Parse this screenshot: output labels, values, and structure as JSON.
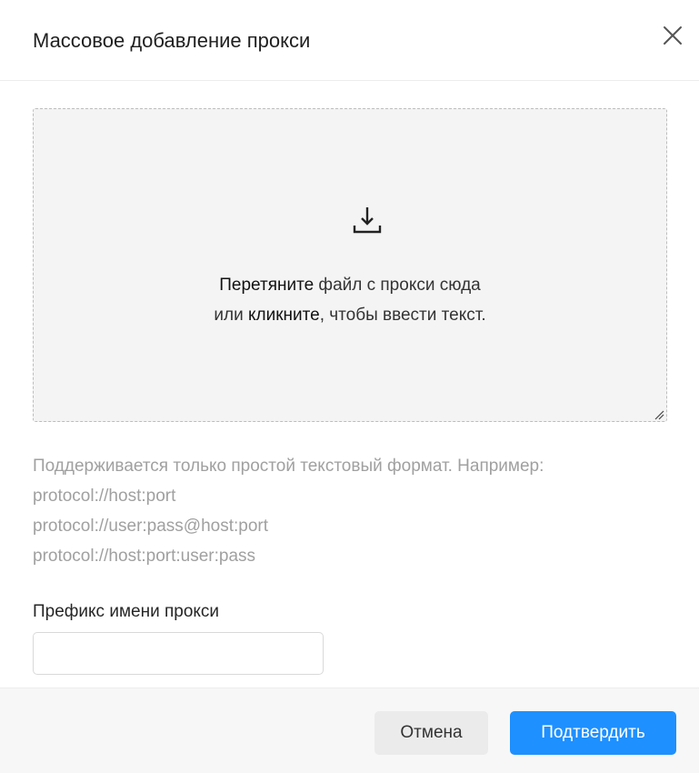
{
  "dialog": {
    "title": "Массовое добавление прокси",
    "close_icon": "close-icon"
  },
  "dropzone": {
    "icon": "download-icon",
    "line1_bold": "Перетяните",
    "line1_rest": " файл с прокси сюда",
    "line2_pre": "или ",
    "line2_bold": "кликните",
    "line2_rest": ", чтобы ввести текст."
  },
  "hint": {
    "intro": "Поддерживается только простой текстовый формат. Например:",
    "examples": [
      "protocol://host:port",
      "protocol://user:pass@host:port",
      "protocol://host:port:user:pass"
    ]
  },
  "prefix": {
    "label": "Префикс имени прокси",
    "value": "",
    "placeholder": ""
  },
  "footer": {
    "cancel_label": "Отмена",
    "confirm_label": "Подтвердить"
  },
  "colors": {
    "primary": "#1e90ff",
    "dropzone_bg": "#f4f4f4",
    "hint_text": "#a0a0a0"
  }
}
